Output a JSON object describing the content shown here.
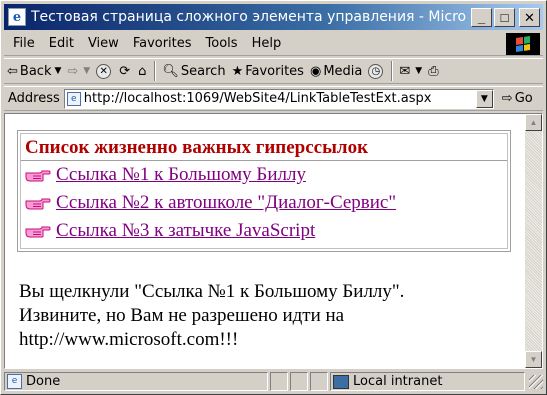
{
  "window": {
    "title": "Тестовая страница сложного элемента управления - Microsoft Internet Explorer",
    "title_visible": "Тестовая страница сложного элемента управления - Micro"
  },
  "menu": [
    "File",
    "Edit",
    "View",
    "Favorites",
    "Tools",
    "Help"
  ],
  "toolbar": {
    "back": "Back",
    "search": "Search",
    "favorites": "Favorites",
    "media": "Media"
  },
  "address": {
    "label": "Address",
    "url": "http://localhost:1069/WebSite4/LinkTableTestExt.aspx",
    "go": "Go"
  },
  "page": {
    "table_title": "Список жизненно важных гиперссылок",
    "links": [
      "Ссылка №1 к Большому Биллу",
      "Ссылка №2 к автошколе \"Диалог-Сервис\"",
      "Ссылка №3 к затычке JavaScript"
    ],
    "message_lines": [
      "Вы щелкнули \"Ссылка №1 к Большому Биллу\".",
      "Извините, но Вам не разрешено идти на",
      "http://www.microsoft.com!!!"
    ]
  },
  "status": {
    "text": "Done",
    "zone": "Local intranet"
  },
  "colors": {
    "titlebar_start": "#0a246a",
    "titlebar_end": "#a6caf0",
    "header_red": "#b00000",
    "visited_link": "#800080",
    "hand_icon": "#e0209a"
  },
  "icons": {
    "link_bullet": "pointing-hand-icon",
    "app": "ie-page-icon"
  }
}
